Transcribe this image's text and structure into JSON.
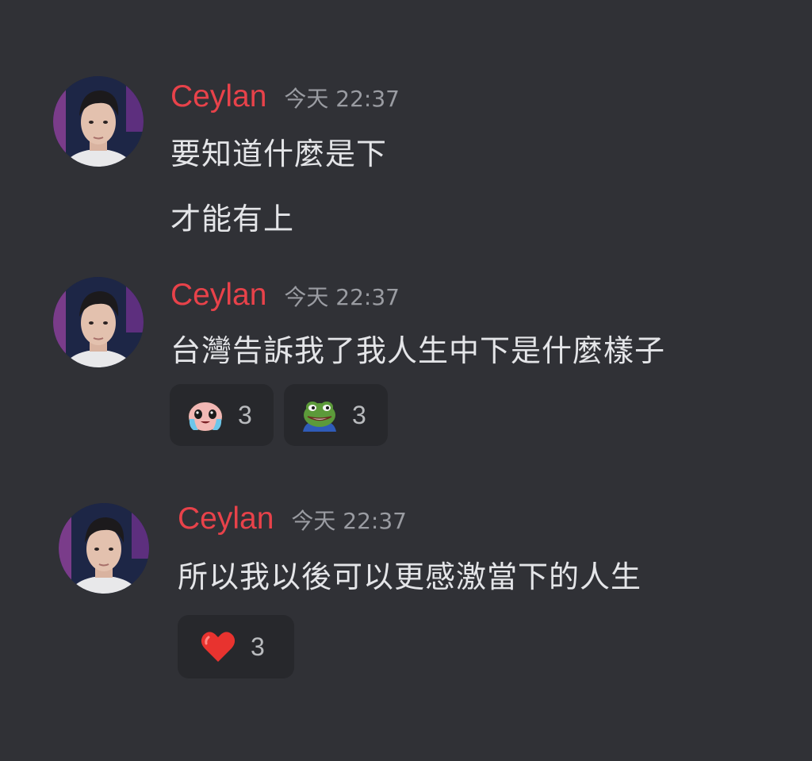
{
  "messages": [
    {
      "username": "Ceylan",
      "timestamp": "今天 22:37",
      "lines": [
        "要知道什麼是下",
        "才能有上"
      ],
      "reactions": []
    },
    {
      "username": "Ceylan",
      "timestamp": "今天 22:37",
      "lines": [
        "台灣告訴我了我人生中下是什麼樣子"
      ],
      "reactions": [
        {
          "emoji": "crying-face-emoji",
          "count": "3"
        },
        {
          "emoji": "pepe-frog-emoji",
          "count": "3"
        }
      ]
    },
    {
      "username": "Ceylan",
      "timestamp": "今天 22:37",
      "lines": [
        "所以我以後可以更感激當下的人生"
      ],
      "reactions": [
        {
          "emoji": "red-heart-emoji",
          "count": "3"
        }
      ]
    }
  ],
  "colors": {
    "background": "#303136",
    "username": "#e8424a",
    "timestamp": "#9a9ca2",
    "message_text": "#e4e5e8",
    "reaction_bg": "#27282c"
  }
}
